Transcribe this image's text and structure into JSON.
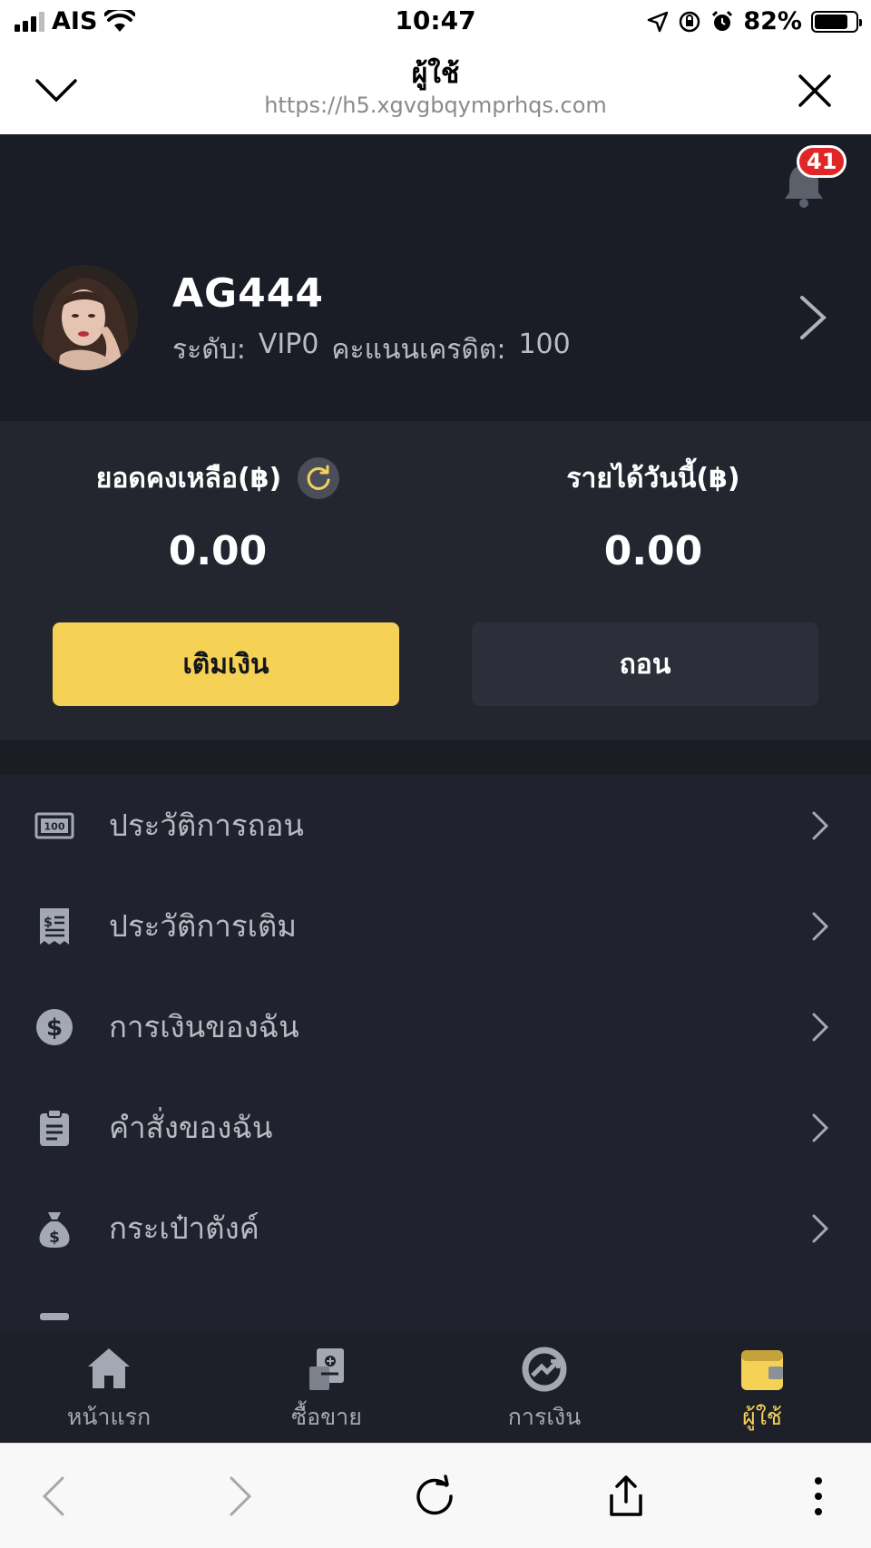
{
  "status_bar": {
    "carrier": "AIS",
    "time": "10:47",
    "battery": "82%",
    "battery_level": 0.82
  },
  "browser": {
    "title": "ผู้ใช้",
    "url": "https://h5.xgvgbqymprhqs.com"
  },
  "notifications": {
    "count": "41"
  },
  "profile": {
    "username": "AG444",
    "level_label": "ระดับ:",
    "level_value": "VIP0",
    "credit_label": "คะแนนเครดิต:",
    "credit_value": "100"
  },
  "balance": {
    "balance_label": "ยอดคงเหลือ(฿)",
    "balance_value": "0.00",
    "income_label": "รายได้วันนี้(฿)",
    "income_value": "0.00",
    "deposit_label": "เติมเงิน",
    "withdraw_label": "ถอน"
  },
  "menu": [
    {
      "label": "ประวัติการถอน",
      "icon": "banknote-icon"
    },
    {
      "label": "ประวัติการเติม",
      "icon": "receipt-icon"
    },
    {
      "label": "การเงินของฉัน",
      "icon": "dollar-circle-icon"
    },
    {
      "label": "คำสั่งของฉัน",
      "icon": "clipboard-icon"
    },
    {
      "label": "กระเป๋าตังค์",
      "icon": "money-bag-icon"
    }
  ],
  "tabs": [
    {
      "label": "หน้าแรก",
      "icon": "home-icon"
    },
    {
      "label": "ซื้อขาย",
      "icon": "trade-icon"
    },
    {
      "label": "การเงิน",
      "icon": "finance-icon"
    },
    {
      "label": "ผู้ใช้",
      "icon": "wallet-icon",
      "active": true
    }
  ],
  "colors": {
    "accent": "#f5d155",
    "background": "#20232d",
    "badge": "#e02727"
  }
}
